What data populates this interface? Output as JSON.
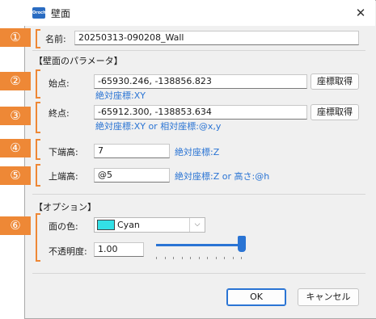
{
  "dialog": {
    "title": "壁面",
    "app_icon": "Orochi",
    "close_glyph": "✕"
  },
  "badges": [
    "①",
    "②",
    "③",
    "④",
    "⑤",
    "⑥"
  ],
  "name_row": {
    "label": "名前:",
    "value": "20250313-090208_Wall"
  },
  "wall_params": {
    "header": "【壁面のパラメータ】",
    "start": {
      "label": "始点:",
      "value": "-65930.246, -138856.823",
      "button": "座標取得",
      "hint": "絶対座標:XY"
    },
    "end": {
      "label": "終点:",
      "value": "-65912.300, -138853.634",
      "button": "座標取得",
      "hint": "絶対座標:XY  or  相対座標:@x,y"
    },
    "bottom": {
      "label": "下端高:",
      "value": "7",
      "hint": "絶対座標:Z"
    },
    "top": {
      "label": "上端高:",
      "value": "@5",
      "hint": "絶対座標:Z  or  高さ:@h"
    }
  },
  "options": {
    "header": "【オプション】",
    "color": {
      "label": "面の色:",
      "selected": "Cyan",
      "swatch_color": "#33e0e6"
    },
    "opacity": {
      "label": "不透明度:",
      "value": "1.00",
      "level": 1.0
    }
  },
  "footer": {
    "ok": "OK",
    "cancel": "キャンセル"
  },
  "colors": {
    "accent": "#2a74d4",
    "badge": "#ee8836"
  }
}
